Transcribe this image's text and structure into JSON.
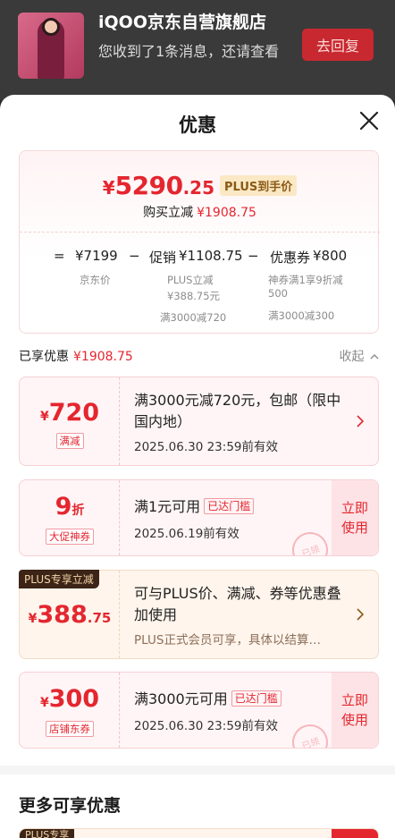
{
  "notification": {
    "title": "iQOO京东自营旗舰店",
    "message": "您收到了1条消息，还请查看",
    "reply_label": "去回复"
  },
  "sheet": {
    "title": "优惠",
    "close_icon": "close-icon"
  },
  "summary": {
    "price_symbol": "¥",
    "price_int": "5290",
    "price_dec": ".25",
    "plus_tag": "PLUS到手价",
    "instant_label": "购买立减",
    "instant_value": "¥1908.75",
    "calc": {
      "eq": "=",
      "jd_price": "¥7199",
      "jd_price_label": "京东价",
      "minus1": "−",
      "promo_label": "促销",
      "promo_value": "¥1108.75",
      "promo_sub1": "PLUS立减",
      "promo_sub2": "¥388.75元",
      "promo_sub3": "满3000减720",
      "minus2": "−",
      "coupon_label": "优惠券",
      "coupon_value": "¥800",
      "coupon_sub1": "神券满1享9折减",
      "coupon_sub2": "500",
      "coupon_sub3": "满3000减300"
    }
  },
  "enjoyed": {
    "label": "已享优惠",
    "value": "¥1908.75",
    "collapse_label": "收起"
  },
  "coupons": [
    {
      "symbol": "¥",
      "amount": "720",
      "tag": "满减",
      "desc": "满3000元减720元，包邮（限中国内地）",
      "date": "2025.06.30 23:59前有效"
    },
    {
      "amount": "9",
      "unit": "折",
      "tag": "大促神券",
      "desc": "满1元可用",
      "badge": "已达门槛",
      "date": "2025.06.19前有效",
      "use_label": "立即使用",
      "stamp": "已领"
    },
    {
      "corner": "PLUS专享立减",
      "symbol": "¥",
      "amount": "388",
      "dec": ".75",
      "desc": "可与PLUS价、满减、券等优惠叠加使用",
      "sub": "PLUS正式会员可享，具体以结算…"
    },
    {
      "symbol": "¥",
      "amount": "300",
      "tag": "店铺东券",
      "desc": "满3000元可用",
      "badge": "已达门槛",
      "date": "2025.06.30 23:59前有效",
      "use_label": "立即使用",
      "stamp": "已领"
    }
  ],
  "more": {
    "title": "更多可享优惠",
    "strip_corner": "PLUS专享"
  },
  "colors": {
    "accent": "#e4262f",
    "plus_gold": "#8a5a16"
  }
}
